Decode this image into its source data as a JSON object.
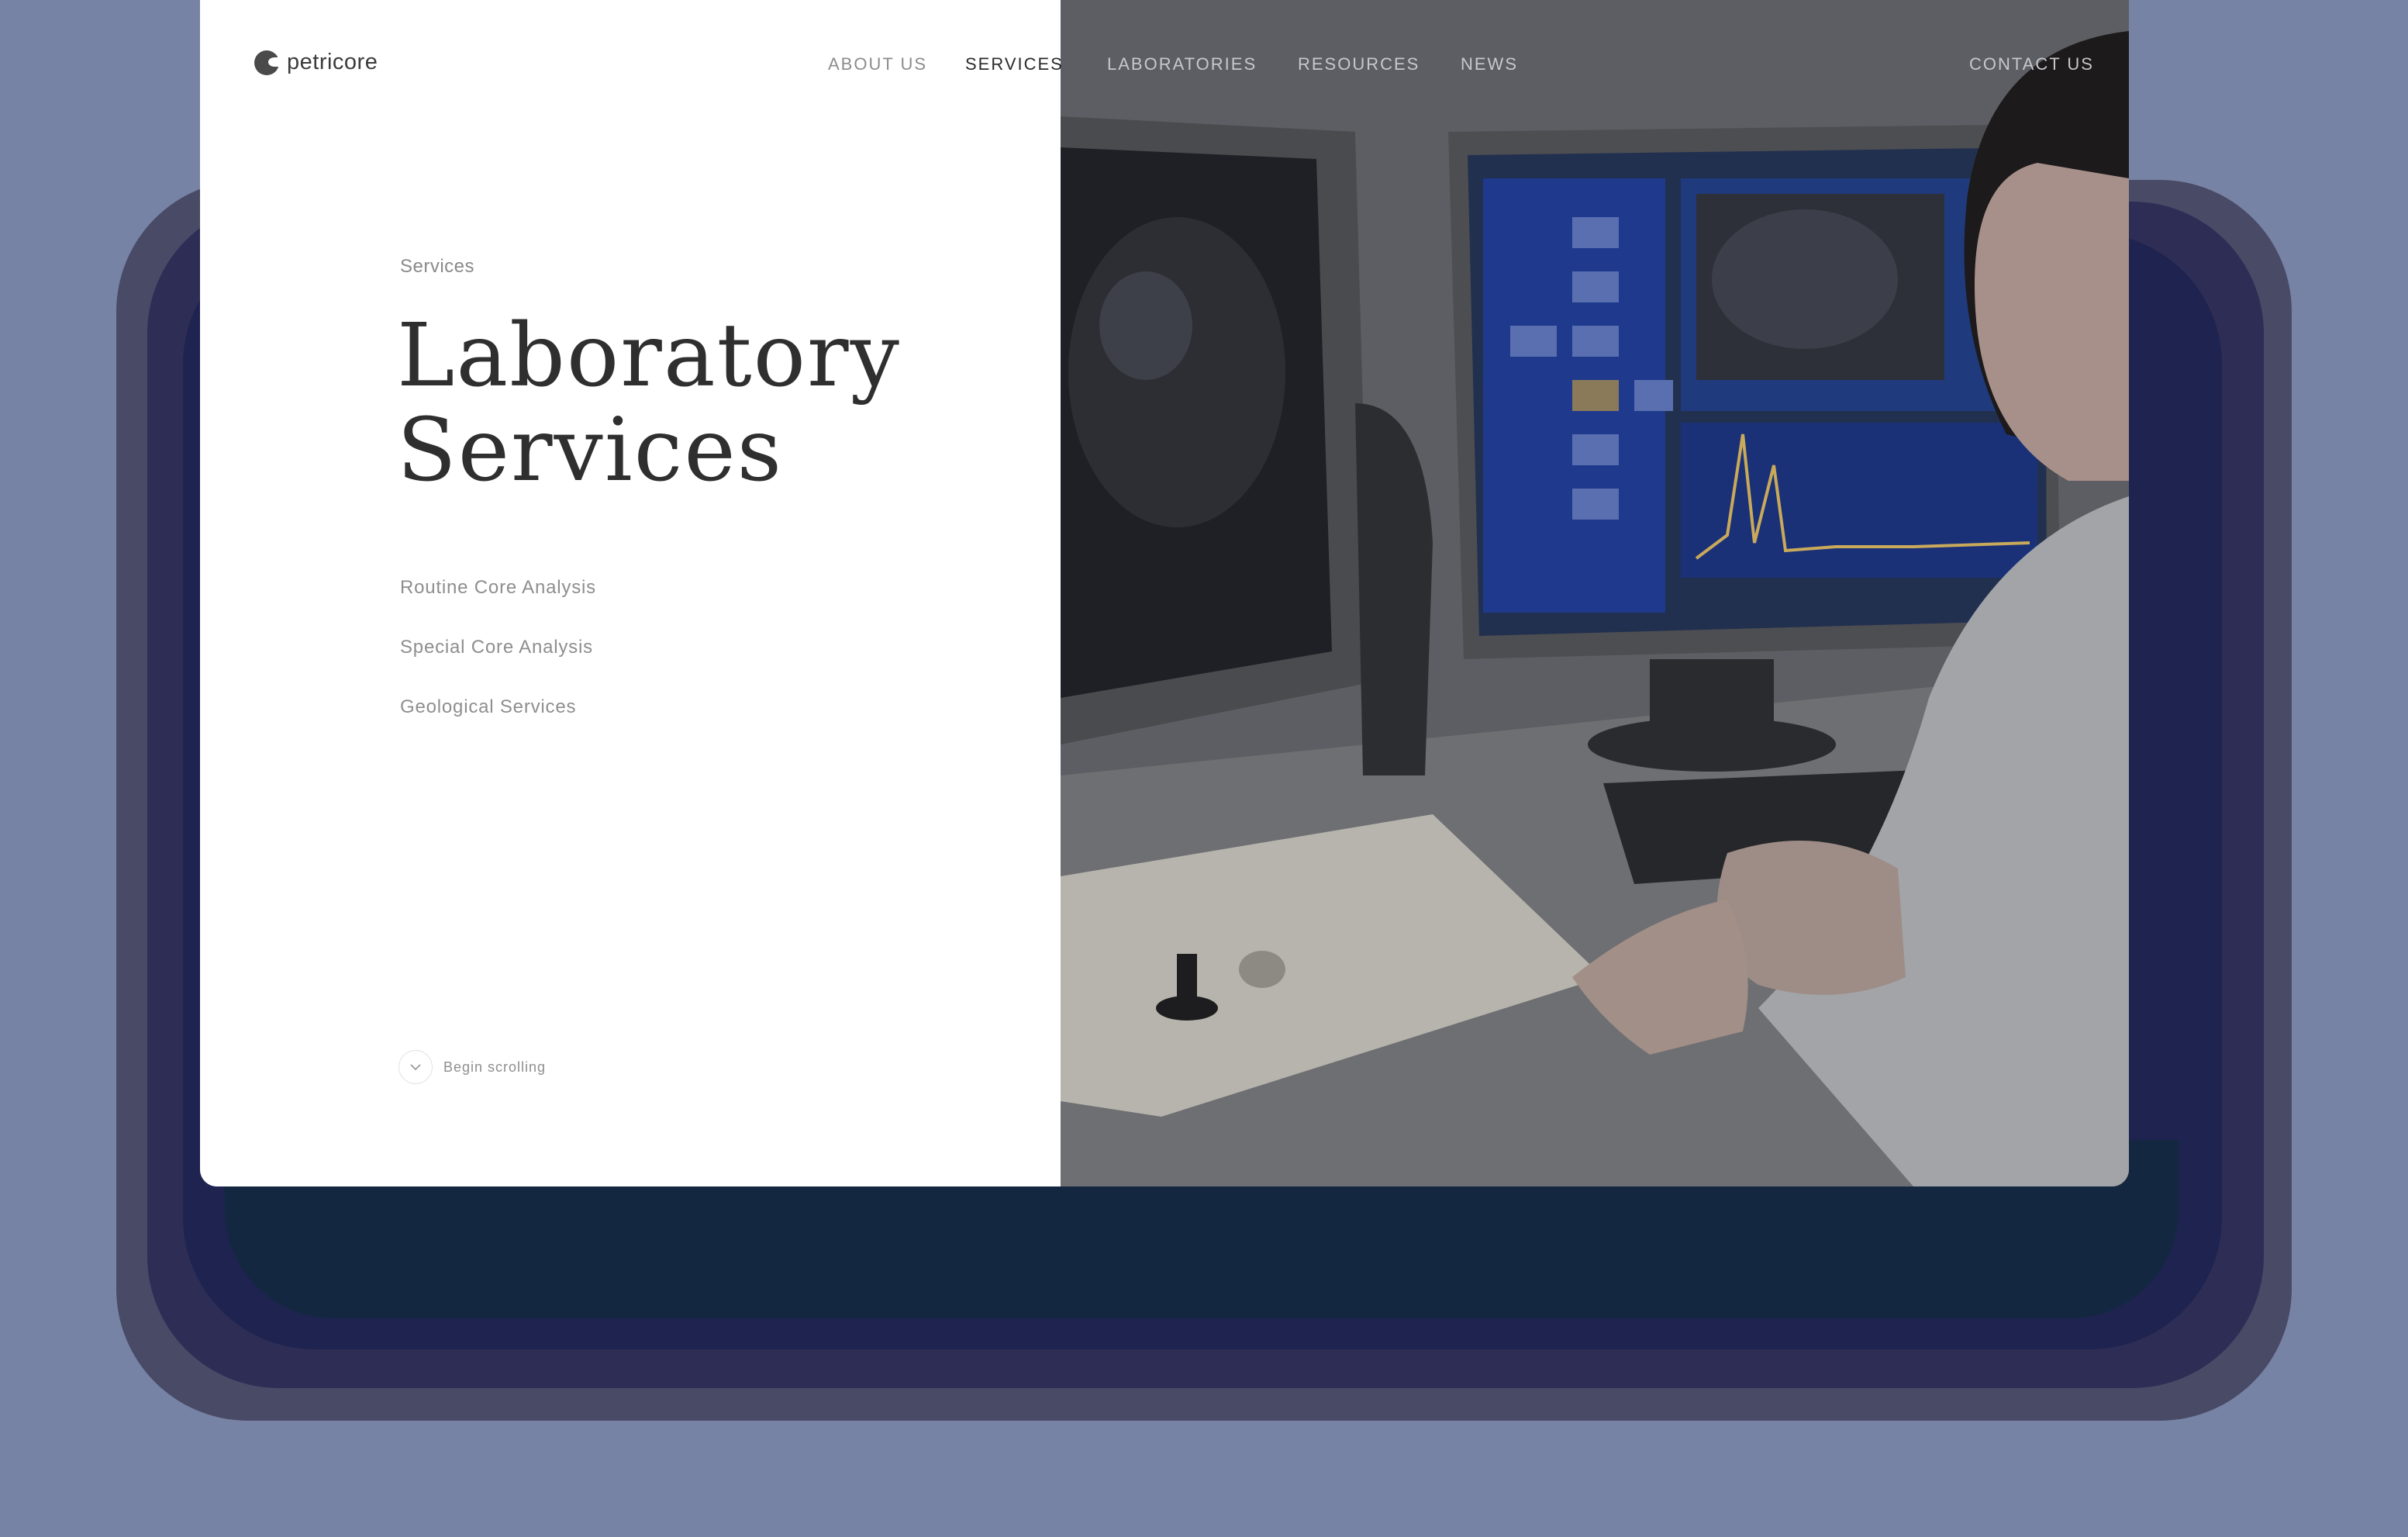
{
  "brand": {
    "name": "petricore"
  },
  "nav": {
    "items": [
      {
        "label": "ABOUT US"
      },
      {
        "label": "SERVICES"
      },
      {
        "label": "LABORATORIES"
      },
      {
        "label": "RESOURCES"
      },
      {
        "label": "NEWS"
      }
    ],
    "contact_label": "CONTACT US",
    "active": "SERVICES"
  },
  "hero": {
    "eyebrow": "Services",
    "title": "Laboratory Services",
    "links": [
      {
        "label": "Routine Core Analysis"
      },
      {
        "label": "Special Core Analysis"
      },
      {
        "label": "Geological Services"
      }
    ],
    "scroll_label": "Begin scrolling"
  },
  "colors": {
    "page_background": "#7783a5",
    "text_primary": "#2f2f2f",
    "text_muted": "#8e8e8e",
    "photo_overlay": "#5c5d63",
    "screen_blue": "#1f3a8c"
  },
  "icons": {
    "scroll": "chevron-down-icon",
    "logo": "petricore-logo-icon"
  }
}
